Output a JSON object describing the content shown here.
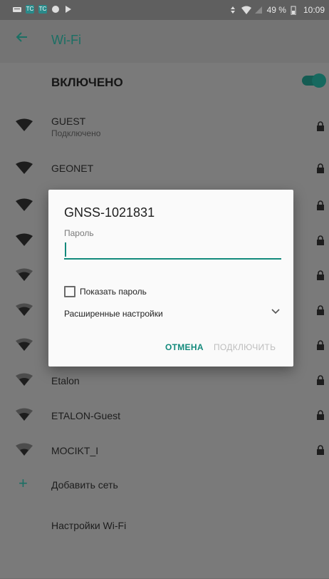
{
  "status_bar": {
    "battery_percent": "49 %",
    "time": "10:09",
    "tc_label": "TC"
  },
  "app_bar": {
    "title": "Wi-Fi"
  },
  "master": {
    "label": "ВКЛЮЧЕНО",
    "enabled": true
  },
  "networks": [
    {
      "ssid": "GUEST",
      "status": "Подключено",
      "secured": true
    },
    {
      "ssid": "GEONET",
      "secured": true
    },
    {
      "ssid": "",
      "secured": true
    },
    {
      "ssid": "",
      "secured": true
    },
    {
      "ssid": "",
      "secured": true
    },
    {
      "ssid": "",
      "secured": true
    },
    {
      "ssid": "",
      "secured": true
    },
    {
      "ssid": "Etalon",
      "secured": true
    },
    {
      "ssid": "ETALON-Guest",
      "secured": true
    },
    {
      "ssid": "MOCIKT_I",
      "secured": true
    }
  ],
  "add_network": {
    "label": "Добавить сеть",
    "icon": "plus-icon"
  },
  "wifi_settings": {
    "label": "Настройки Wi-Fi"
  },
  "dialog": {
    "title": "GNSS-1021831",
    "password_label": "Пароль",
    "password_value": "",
    "show_password_label": "Показать пароль",
    "show_password_checked": false,
    "advanced_label": "Расширенные настройки",
    "cancel_label": "ОТМЕНА",
    "connect_label": "ПОДКЛЮЧИТЬ"
  },
  "colors": {
    "accent": "#138a7c",
    "dim_accent": "#1b6f64",
    "dialog_bg": "#fafafa",
    "scrim": "#7a7a7a"
  }
}
